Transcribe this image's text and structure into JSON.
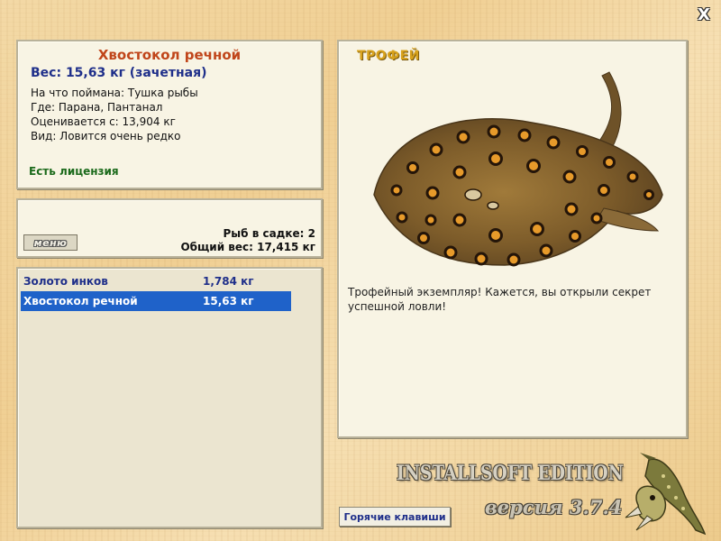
{
  "fish": {
    "name": "Хвостокол речной",
    "weight_line": "Вес: 15,63 кг (зачетная)",
    "details": [
      "На что поймана: Тушка рыбы",
      "Где: Парана, Пантанал",
      "Оценивается с: 13,904 кг",
      "Вид: Ловится очень редко"
    ],
    "license": "Есть лицензия"
  },
  "stats": {
    "menu_label": "меню",
    "fish_count": "Рыб в садке: 2",
    "total_weight": "Общий вес: 17,415 кг"
  },
  "catch_list": [
    {
      "name": "Золото инков",
      "weight": "1,784 кг",
      "selected": false
    },
    {
      "name": "Хвостокол речной",
      "weight": "15,63 кг",
      "selected": true
    }
  ],
  "trophy": {
    "label": "ТРОФЕЙ",
    "description": "Трофейный экземпляр! Кажется, вы открыли секрет успешной ловли!"
  },
  "footer": {
    "hotkeys_label": "Горячие клавиши",
    "edition": "INSTALLSOFT EDITION",
    "version": "версия 3.7.4"
  },
  "window": {
    "close_label": "X"
  },
  "colors": {
    "title": "#c0451a",
    "weight": "#1f2f8a",
    "license": "#1b6a1b",
    "selection": "#1f62c9",
    "trophy_label": "#d8a21c"
  }
}
